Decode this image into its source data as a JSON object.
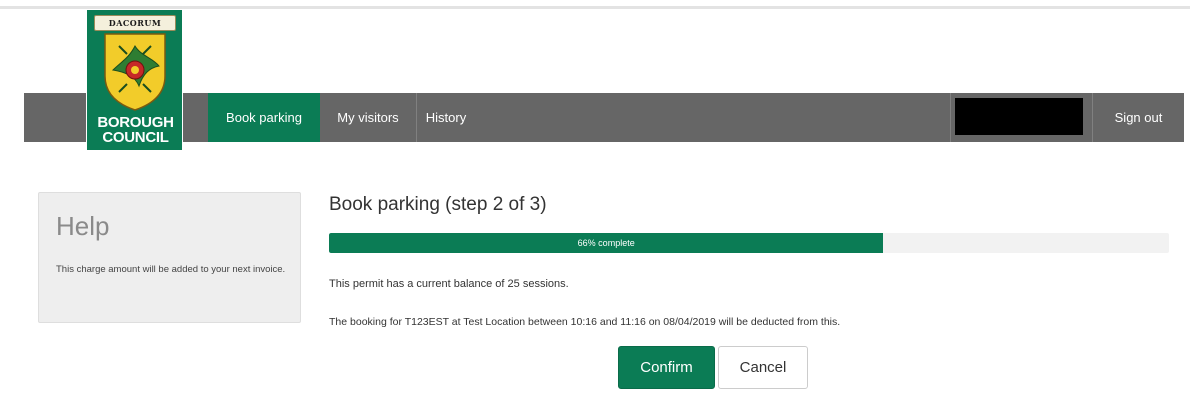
{
  "logo": {
    "banner": "DACORUM",
    "line1": "BOROUGH",
    "line2": "COUNCIL"
  },
  "nav": {
    "items": [
      {
        "label": "Book parking",
        "active": true
      },
      {
        "label": "My visitors",
        "active": false
      },
      {
        "label": "History",
        "active": false
      }
    ],
    "user_redacted": true,
    "signout_label": "Sign out"
  },
  "help": {
    "title": "Help",
    "text": "This charge amount will be added to your next invoice."
  },
  "main": {
    "title": "Book parking (step 2 of 3)",
    "progress": {
      "percent": 66,
      "label": "66% complete"
    },
    "balance_text": "This permit has a current balance of 25 sessions.",
    "booking_text": "The booking for T123EST at Test Location between 10:16 and 11:16 on 08/04/2019 will be deducted from this."
  },
  "actions": {
    "confirm_label": "Confirm",
    "cancel_label": "Cancel"
  },
  "colors": {
    "brand_green": "#0b7c55",
    "nav_grey": "#666666",
    "shield_yellow": "#f2cc2a"
  },
  "icons": {
    "logo": "council-crest-icon"
  }
}
